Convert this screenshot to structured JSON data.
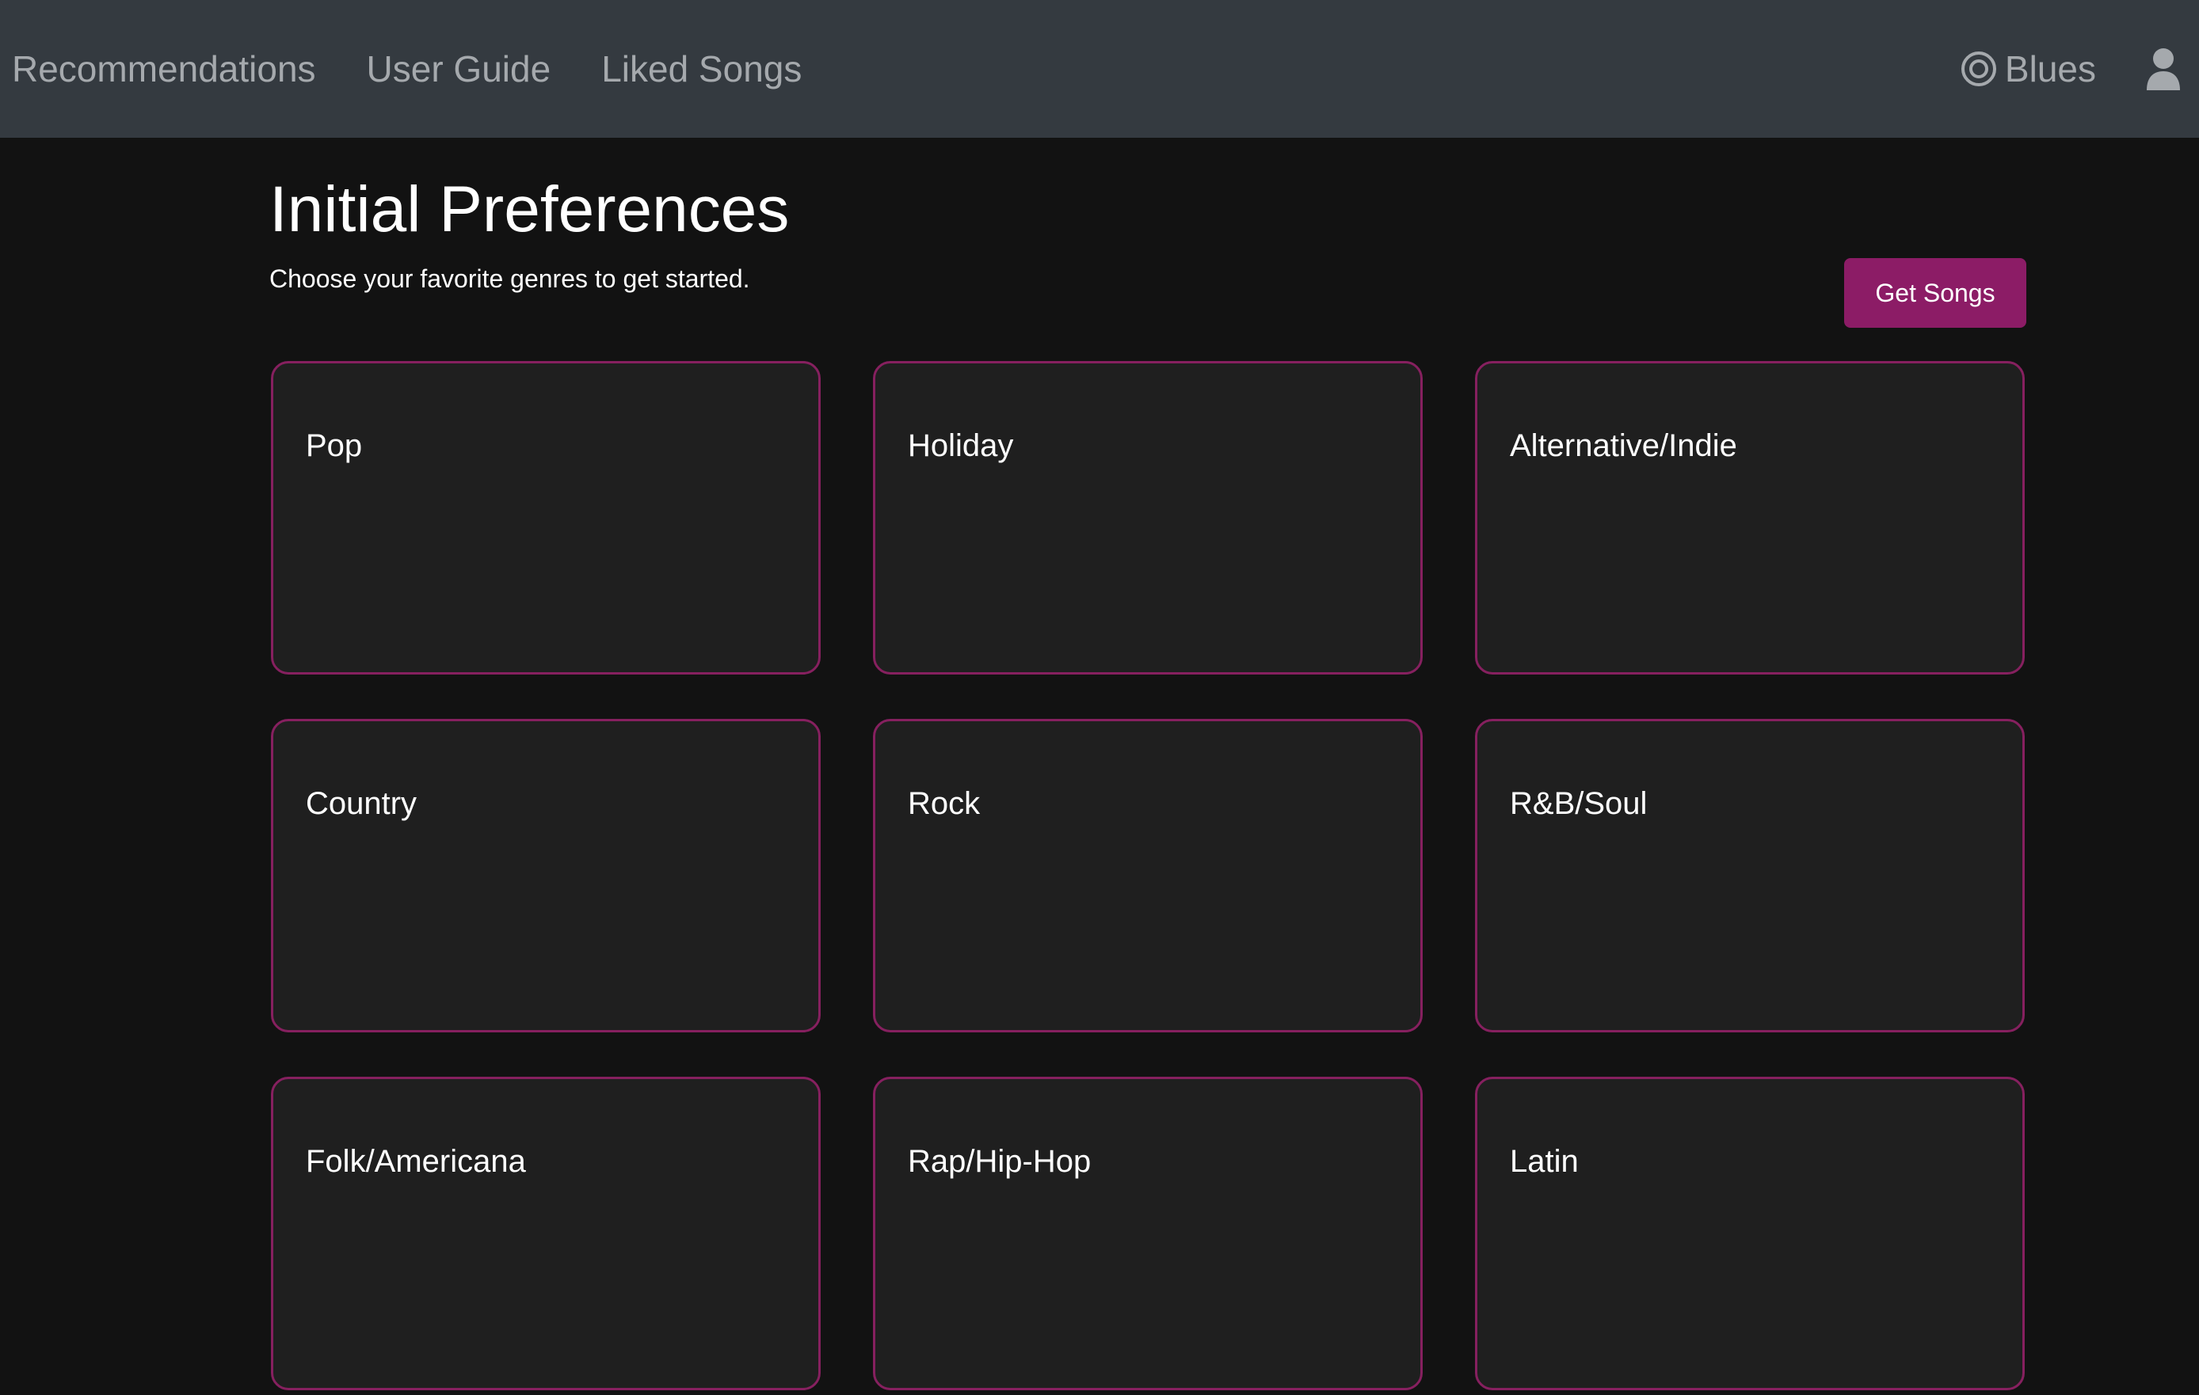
{
  "nav": {
    "links": [
      "Recommendations",
      "User Guide",
      "Liked Songs"
    ],
    "brand_label": "Blues",
    "brand_icon": "target-icon",
    "user_icon": "user-icon"
  },
  "main": {
    "title": "Initial Preferences",
    "subtitle": "Choose your favorite genres to get started.",
    "get_songs_label": "Get Songs"
  },
  "genres": [
    "Pop",
    "Holiday",
    "Alternative/Indie",
    "Country",
    "Rock",
    "R&B/Soul",
    "Folk/Americana",
    "Rap/Hip-Hop",
    "Latin"
  ],
  "colors": {
    "navbar": "#343a40",
    "background": "#121212",
    "card": "#1f1f1f",
    "accent": "#8c1c66",
    "nav_text": "#a5a9ad"
  }
}
